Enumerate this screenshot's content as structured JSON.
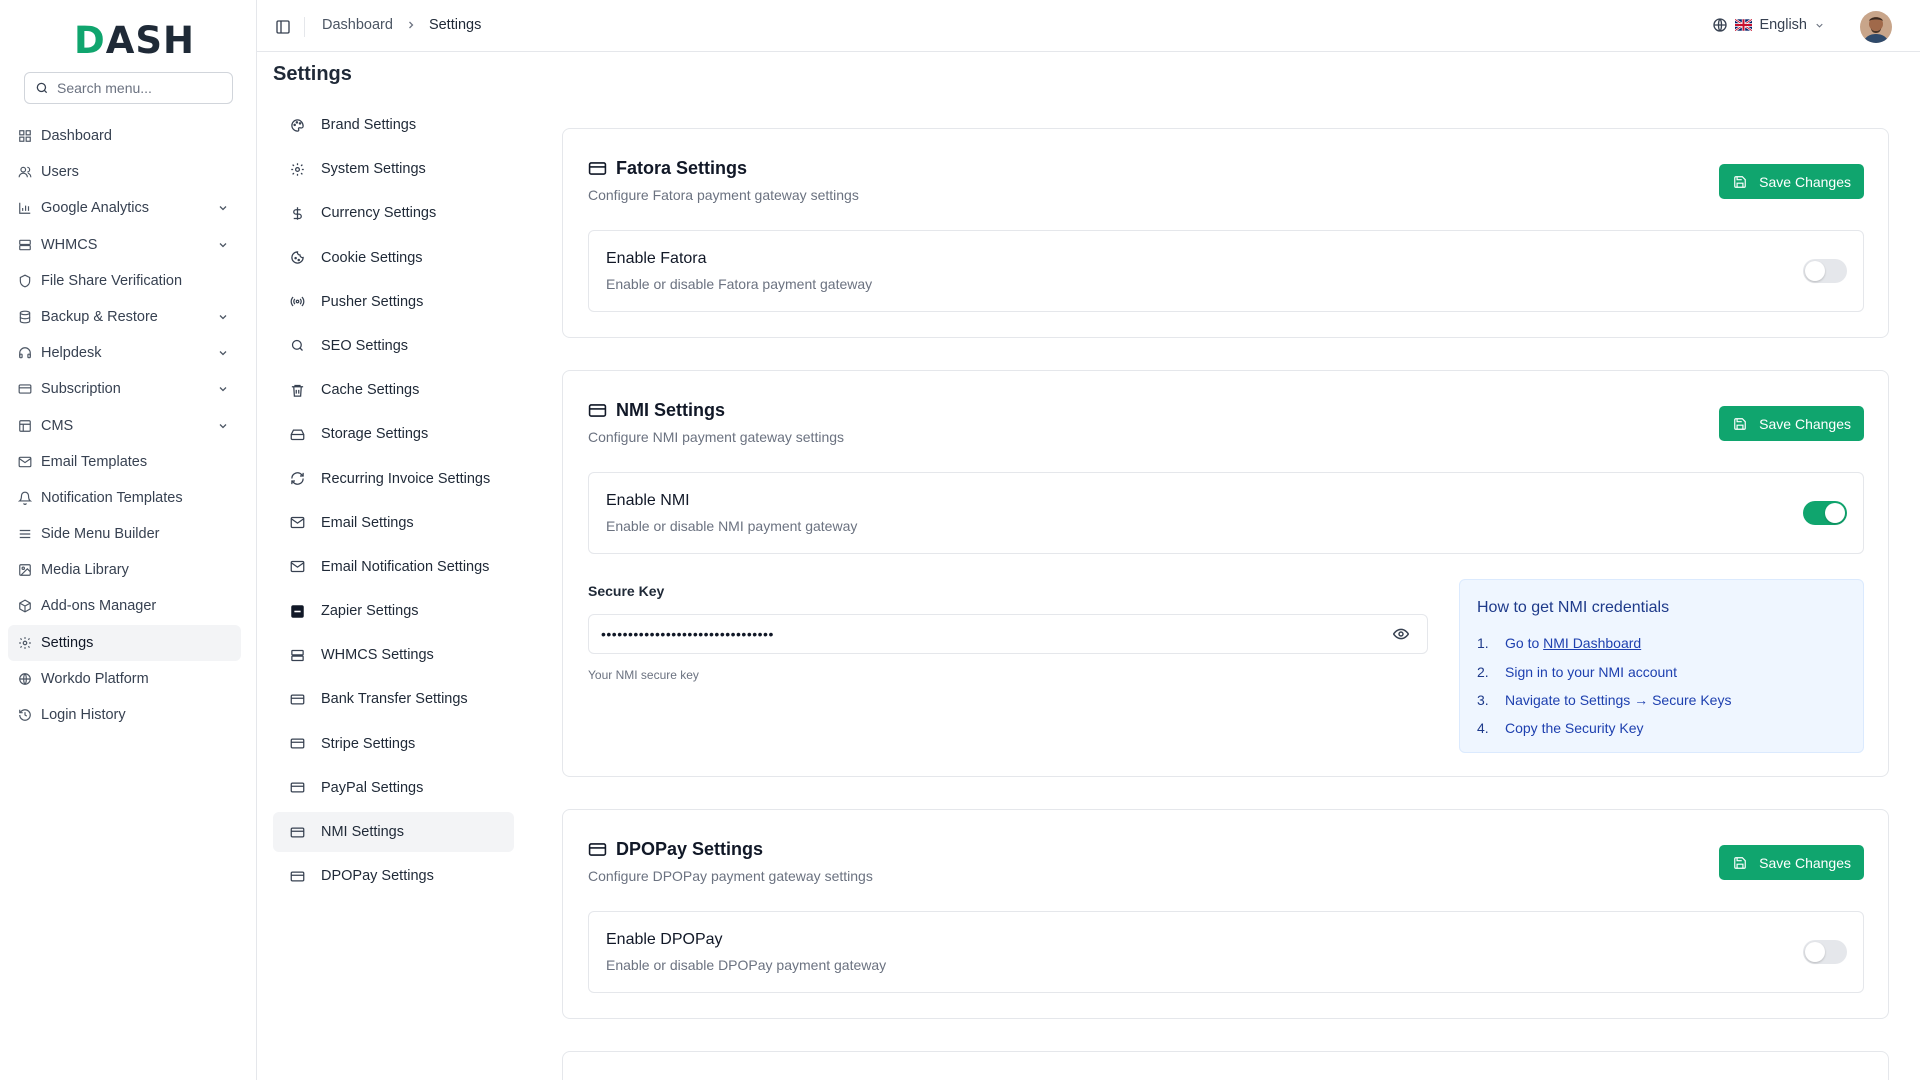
{
  "brand": {
    "logo_first": "D",
    "logo_rest": "ASH",
    "accent": "#10a56e"
  },
  "search": {
    "placeholder": "Search menu..."
  },
  "sidebar": {
    "items": [
      {
        "label": "Dashboard",
        "icon": "dashboard-icon"
      },
      {
        "label": "Users",
        "icon": "users-icon"
      },
      {
        "label": "Google Analytics",
        "icon": "chart-icon",
        "expandable": true
      },
      {
        "label": "WHMCS",
        "icon": "server-icon",
        "expandable": true
      },
      {
        "label": "File Share Verification",
        "icon": "shield-icon"
      },
      {
        "label": "Backup & Restore",
        "icon": "database-icon",
        "expandable": true
      },
      {
        "label": "Helpdesk",
        "icon": "headset-icon",
        "expandable": true
      },
      {
        "label": "Subscription",
        "icon": "card-icon",
        "expandable": true
      },
      {
        "label": "CMS",
        "icon": "layout-icon",
        "expandable": true
      },
      {
        "label": "Email Templates",
        "icon": "mail-icon"
      },
      {
        "label": "Notification Templates",
        "icon": "bell-icon"
      },
      {
        "label": "Side Menu Builder",
        "icon": "menu-icon"
      },
      {
        "label": "Media Library",
        "icon": "image-icon"
      },
      {
        "label": "Add-ons Manager",
        "icon": "package-icon"
      },
      {
        "label": "Settings",
        "icon": "gear-icon",
        "active": true
      },
      {
        "label": "Workdo Platform",
        "icon": "globe-icon"
      },
      {
        "label": "Login History",
        "icon": "history-icon"
      }
    ]
  },
  "topbar": {
    "breadcrumb": [
      "Dashboard",
      "Settings"
    ],
    "language": "English"
  },
  "page": {
    "title": "Settings"
  },
  "settings_nav": [
    {
      "label": "Brand Settings",
      "icon": "palette-icon"
    },
    {
      "label": "System Settings",
      "icon": "gear-icon"
    },
    {
      "label": "Currency Settings",
      "icon": "dollar-icon"
    },
    {
      "label": "Cookie Settings",
      "icon": "cookie-icon"
    },
    {
      "label": "Pusher Settings",
      "icon": "broadcast-icon"
    },
    {
      "label": "SEO Settings",
      "icon": "search-icon"
    },
    {
      "label": "Cache Settings",
      "icon": "trash-icon"
    },
    {
      "label": "Storage Settings",
      "icon": "hard-drive-icon"
    },
    {
      "label": "Recurring Invoice Settings",
      "icon": "refresh-icon"
    },
    {
      "label": "Email Settings",
      "icon": "mail-icon"
    },
    {
      "label": "Email Notification Settings",
      "icon": "mail-icon"
    },
    {
      "label": "Zapier Settings",
      "icon": "zapier-icon"
    },
    {
      "label": "WHMCS Settings",
      "icon": "server-icon"
    },
    {
      "label": "Bank Transfer Settings",
      "icon": "card-icon"
    },
    {
      "label": "Stripe Settings",
      "icon": "card-icon"
    },
    {
      "label": "PayPal Settings",
      "icon": "card-icon"
    },
    {
      "label": "NMI Settings",
      "icon": "card-icon",
      "active": true
    },
    {
      "label": "DPOPay Settings",
      "icon": "card-icon"
    }
  ],
  "fatora": {
    "title": "Fatora Settings",
    "subtitle": "Configure Fatora payment gateway settings",
    "save_label": "Save Changes",
    "toggle_title": "Enable Fatora",
    "toggle_desc": "Enable or disable Fatora payment gateway",
    "enabled": false
  },
  "nmi": {
    "title": "NMI Settings",
    "subtitle": "Configure NMI payment gateway settings",
    "save_label": "Save Changes",
    "toggle_title": "Enable NMI",
    "toggle_desc": "Enable or disable NMI payment gateway",
    "enabled": true,
    "secure_key_label": "Secure Key",
    "secure_key_value": "••••••••••••••••••••••••••••••••",
    "secure_key_help": "Your NMI secure key",
    "help": {
      "title": "How to get NMI credentials",
      "steps": [
        {
          "num": "1.",
          "prefix": "Go to ",
          "link": "NMI Dashboard"
        },
        {
          "num": "2.",
          "text": "Sign in to your NMI account"
        },
        {
          "num": "3.",
          "text": "Navigate to Settings → Secure Keys"
        },
        {
          "num": "4.",
          "text": "Copy the Security Key"
        }
      ]
    }
  },
  "dpopay": {
    "title": "DPOPay Settings",
    "subtitle": "Configure DPOPay payment gateway settings",
    "save_label": "Save Changes",
    "toggle_title": "Enable DPOPay",
    "toggle_desc": "Enable or disable DPOPay payment gateway",
    "enabled": false
  }
}
